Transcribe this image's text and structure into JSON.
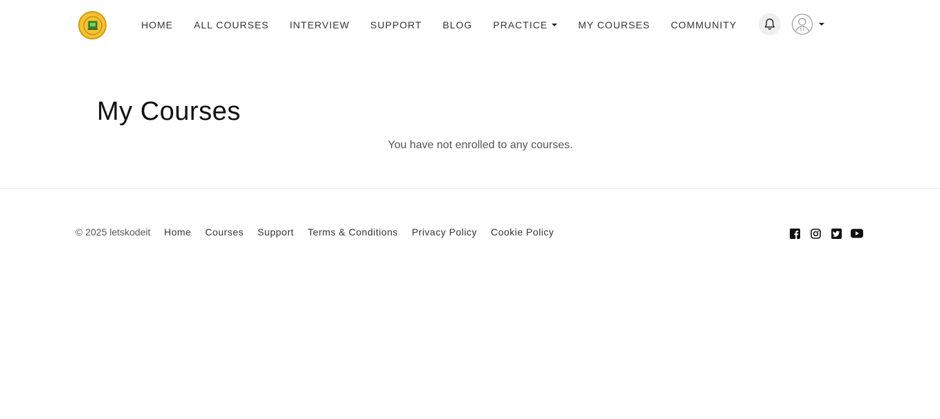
{
  "header": {
    "logo": {
      "icon": "letskodeit-logo"
    },
    "nav": [
      {
        "label": "HOME"
      },
      {
        "label": "ALL COURSES"
      },
      {
        "label": "INTERVIEW"
      },
      {
        "label": "SUPPORT"
      },
      {
        "label": "BLOG"
      },
      {
        "label": "PRACTICE",
        "has_dropdown": true
      },
      {
        "label": "MY COURSES"
      },
      {
        "label": "COMMUNITY"
      }
    ],
    "notifications": {
      "icon": "bell-icon"
    },
    "user_menu": {
      "icon": "user-avatar-icon",
      "has_dropdown": true
    }
  },
  "main": {
    "title": "My Courses",
    "empty_message": "You have not enrolled to any courses."
  },
  "footer": {
    "copyright": "© 2025 letskodeit",
    "links": [
      {
        "label": "Home"
      },
      {
        "label": "Courses"
      },
      {
        "label": "Support"
      },
      {
        "label": "Terms & Conditions"
      },
      {
        "label": "Privacy Policy"
      },
      {
        "label": "Cookie Policy"
      }
    ],
    "social": [
      "facebook-icon",
      "instagram-icon",
      "twitter-icon",
      "youtube-icon"
    ]
  },
  "colors": {
    "background": "#ffffff",
    "text": "#333333",
    "logo_yellow": "#f2c230",
    "divider": "#e6e6e6"
  }
}
